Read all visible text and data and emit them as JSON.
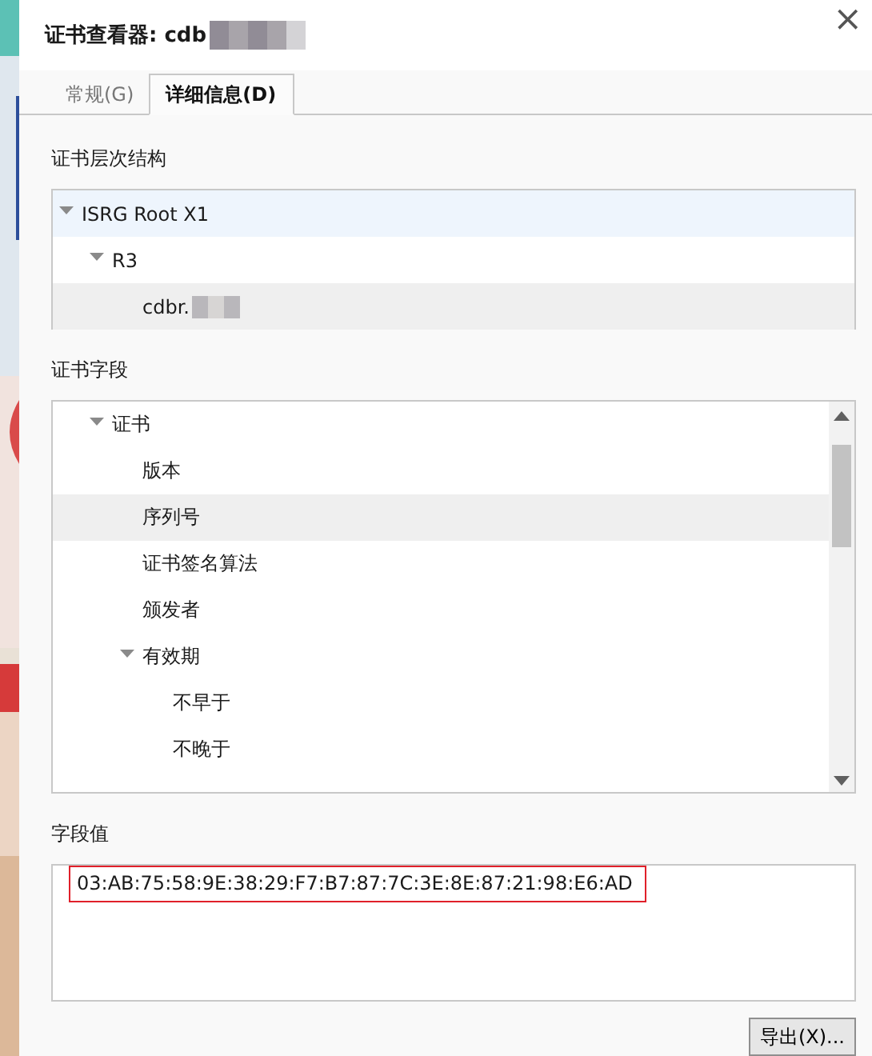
{
  "window": {
    "title": "证书查看器: cdb",
    "close": "×"
  },
  "tabs": [
    {
      "label": "常规(G)",
      "selected": false
    },
    {
      "label": "详细信息(D)",
      "selected": true
    }
  ],
  "hierarchy": {
    "label": "证书层次结构",
    "items": [
      {
        "label": "ISRG Root X1",
        "expanded": true,
        "hovered": true,
        "selected": false,
        "children": [
          {
            "label": "R3",
            "expanded": true,
            "hovered": false,
            "selected": false,
            "children": [
              {
                "label": "cdbr.",
                "selected": true,
                "redacted": true
              }
            ]
          }
        ]
      }
    ]
  },
  "fields": {
    "label": "证书字段",
    "items": [
      {
        "label": "证书",
        "expanded": true,
        "selected": false,
        "children": [
          {
            "label": "版本",
            "selected": false
          },
          {
            "label": "序列号",
            "selected": true
          },
          {
            "label": "证书签名算法",
            "selected": false
          },
          {
            "label": "颁发者",
            "selected": false
          },
          {
            "label": "有效期",
            "expanded": true,
            "selected": false,
            "children": [
              {
                "label": "不早于",
                "selected": false
              },
              {
                "label": "不晚于",
                "selected": false
              }
            ]
          }
        ]
      }
    ]
  },
  "value": {
    "label": "字段值",
    "text": "03:AB:75:58:9E:38:29:F7:B7:87:7C:3E:8E:87:21:98:E6:AD",
    "highlighted": true
  },
  "buttons": [
    {
      "label": "导出(X)..."
    }
  ]
}
